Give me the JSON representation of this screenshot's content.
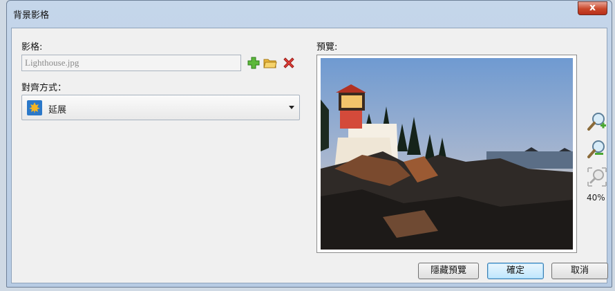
{
  "window": {
    "title": "背景影格",
    "close_label": "x"
  },
  "frame": {
    "label": "影格:",
    "input_value": "Lighthouse.jpg",
    "icons": [
      "add-icon",
      "open-folder-icon",
      "remove-icon"
    ]
  },
  "alignment": {
    "label": "對齊方式：",
    "selected": "延展"
  },
  "preview": {
    "label": "預覽:",
    "zoom_percent": "40%",
    "zoom_icons": [
      "zoom-in-icon",
      "zoom-out-icon",
      "zoom-fit-icon"
    ]
  },
  "buttons": {
    "hide_preview": "隱藏預覽",
    "ok": "確定",
    "cancel": "取消"
  },
  "colors": {
    "accent": "#3c7fb1",
    "close": "#c9472a"
  }
}
